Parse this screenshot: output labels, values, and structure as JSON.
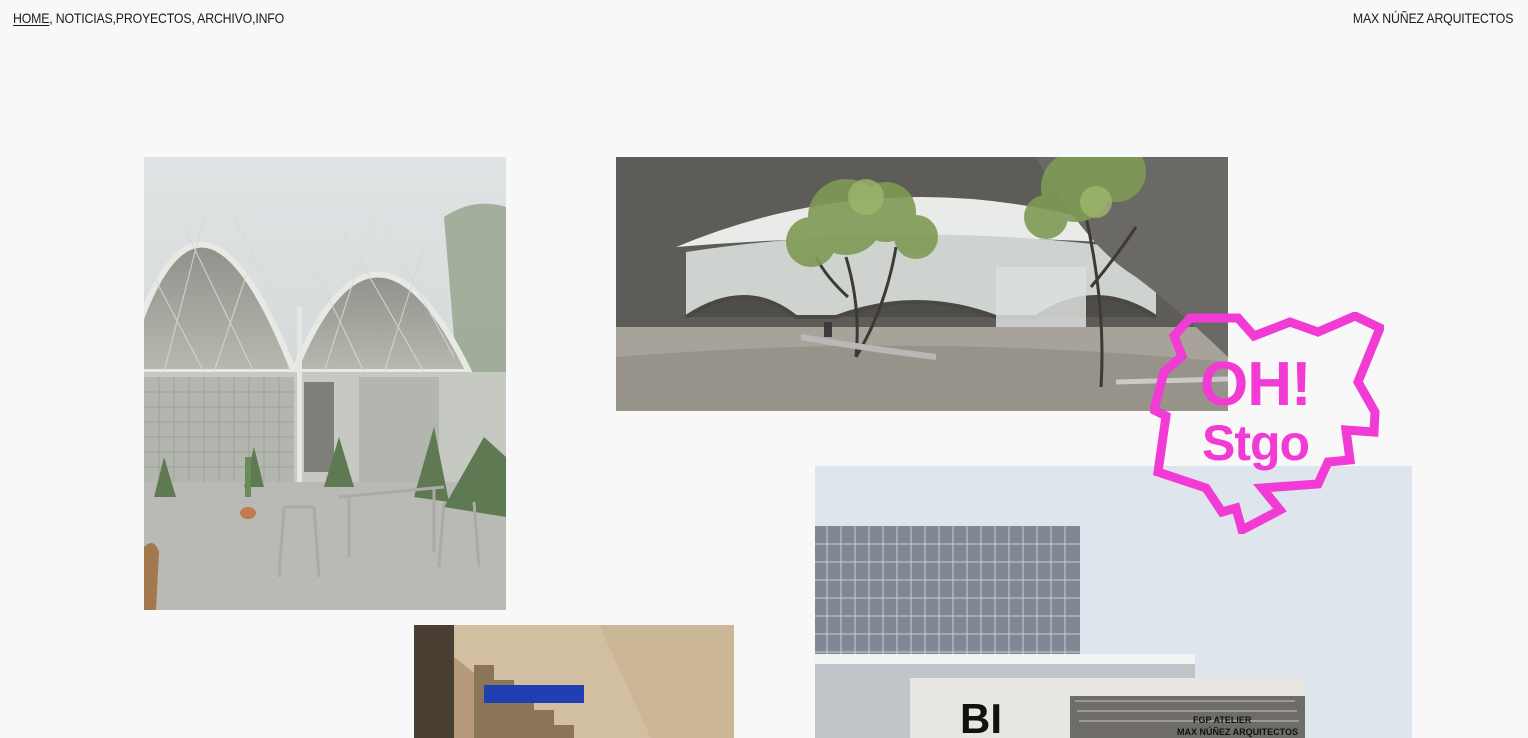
{
  "nav": {
    "items": [
      {
        "label": "HOME",
        "sep": ", "
      },
      {
        "label": "NOTICIAS",
        "sep": ","
      },
      {
        "label": "PROYECTOS",
        "sep": ", "
      },
      {
        "label": "ARCHIVO",
        "sep": ","
      },
      {
        "label": "INFO",
        "sep": ""
      }
    ]
  },
  "brand": "MAX NÚÑEZ ARQUITECTOS",
  "oh_logo": {
    "line1": "OH!",
    "line2": "Stgo",
    "color": "#f23bd4"
  },
  "book": {
    "publisher": "FGP ATELIER",
    "author": "MAX NÚÑEZ ARQUITECTOS",
    "cover_letters": "BI"
  }
}
